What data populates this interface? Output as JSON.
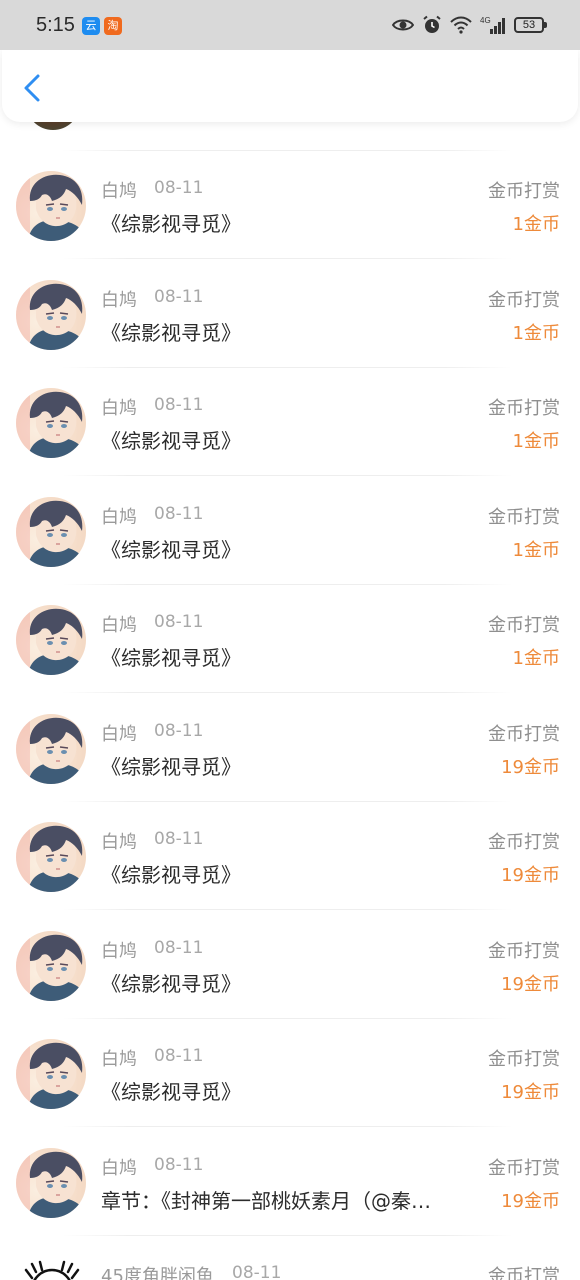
{
  "status_bar": {
    "time": "5:15",
    "app_badges": [
      "云",
      "淘"
    ],
    "battery": "53",
    "network": "4G"
  },
  "header": {
    "back_icon": "chevron-left-icon",
    "accent_color": "#2f8ef2"
  },
  "colors": {
    "amount": "#ee8a3a",
    "name": "#9a9a9a",
    "title": "#2c2c2c"
  },
  "records": [
    {
      "name": "白鸠",
      "date": "08-11",
      "title": "《综影视寻觅》",
      "type": "金币打赏",
      "amount": "1金币"
    },
    {
      "name": "白鸠",
      "date": "08-11",
      "title": "《综影视寻觅》",
      "type": "金币打赏",
      "amount": "1金币"
    },
    {
      "name": "白鸠",
      "date": "08-11",
      "title": "《综影视寻觅》",
      "type": "金币打赏",
      "amount": "1金币"
    },
    {
      "name": "白鸠",
      "date": "08-11",
      "title": "《综影视寻觅》",
      "type": "金币打赏",
      "amount": "1金币"
    },
    {
      "name": "白鸠",
      "date": "08-11",
      "title": "《综影视寻觅》",
      "type": "金币打赏",
      "amount": "1金币"
    },
    {
      "name": "白鸠",
      "date": "08-11",
      "title": "《综影视寻觅》",
      "type": "金币打赏",
      "amount": "19金币"
    },
    {
      "name": "白鸠",
      "date": "08-11",
      "title": "《综影视寻觅》",
      "type": "金币打赏",
      "amount": "19金币"
    },
    {
      "name": "白鸠",
      "date": "08-11",
      "title": "《综影视寻觅》",
      "type": "金币打赏",
      "amount": "19金币"
    },
    {
      "name": "白鸠",
      "date": "08-11",
      "title": "《综影视寻觅》",
      "type": "金币打赏",
      "amount": "19金币"
    },
    {
      "name": "白鸠",
      "date": "08-11",
      "title": "章节：《封神第一部桃妖素月（@秦…",
      "type": "金币打赏",
      "amount": "19金币"
    },
    {
      "name": "45度角胖闲鱼",
      "date": "08-11",
      "title": "",
      "type": "金币打赏",
      "amount": ""
    }
  ]
}
